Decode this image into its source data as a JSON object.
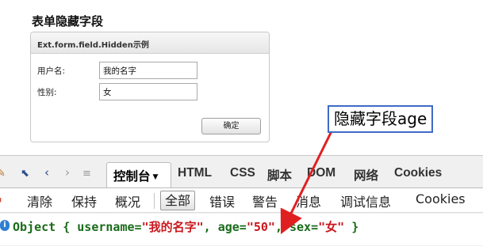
{
  "page_title": "表单隐藏字段",
  "form": {
    "header": "Ext.form.field.Hidden示例",
    "username_label": "用户名:",
    "username_value": "我的名字",
    "gender_label": "性别:",
    "gender_value": "女",
    "confirm_label": "确定"
  },
  "devtools": {
    "tabs": {
      "console": "控制台",
      "html": "HTML",
      "css": "CSS",
      "script": "脚本",
      "dom": "DOM",
      "network": "网络",
      "cookies": "Cookies"
    },
    "filters": {
      "clear": "清除",
      "persist": "保持",
      "profile": "概况",
      "all": "全部",
      "errors": "错误",
      "warnings": "警告",
      "info": "消息",
      "debug": "调试信息",
      "cookies": "Cookies"
    },
    "log": {
      "object_word": "Object",
      "open_brace": "{",
      "username_key": "username=",
      "username_val": "\"我的名字\"",
      "comma1": ",",
      "age_key": "age=",
      "age_val": "\"50\"",
      "comma2": ",",
      "sex_key": "sex=",
      "sex_val": "\"女\"",
      "close_brace": "}"
    }
  },
  "annotation": {
    "callout_text": "隐藏字段age",
    "border_color": "#3e6bc6",
    "arrow_color": "#e02020"
  },
  "icons": [
    "inspect-icon",
    "back-icon",
    "forward-icon",
    "command-line-icon",
    "dropdown-arrow-icon",
    "info-icon"
  ]
}
